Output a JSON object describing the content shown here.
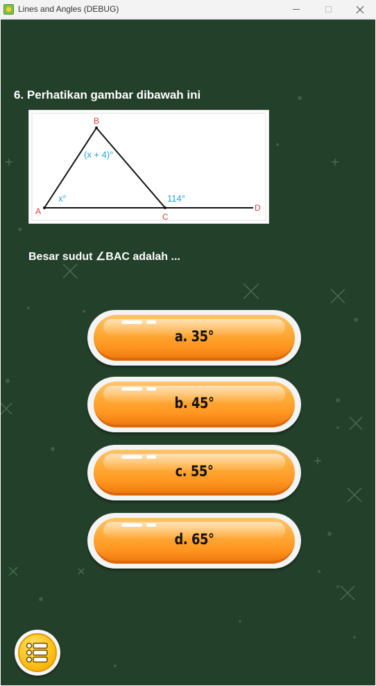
{
  "window": {
    "title": "Lines and Angles (DEBUG)",
    "controls": {
      "minimize": "minimize-icon",
      "maximize": "maximize-icon",
      "close": "close-icon"
    }
  },
  "question": {
    "title": "6. Perhatikan gambar dibawah ini",
    "text": "Besar sudut ∠BAC adalah ...",
    "figure": {
      "label_b": "B",
      "label_a": "A",
      "label_c": "C",
      "label_d": "D",
      "angle_b": "(x + 4)°",
      "angle_a": "x°",
      "angle_c": "114°"
    }
  },
  "answers": [
    {
      "label": "a. 35°"
    },
    {
      "label": "b. 45°"
    },
    {
      "label": "c. 55°"
    },
    {
      "label": "d. 65°"
    }
  ],
  "menu_button": {
    "icon": "list-menu-icon"
  },
  "colors": {
    "background": "#23402a",
    "answer_orange": "#ff9520",
    "menu_yellow": "#ffc21a",
    "figure_label_red": "#e03a3a",
    "figure_angle_blue": "#1aa6e0"
  }
}
